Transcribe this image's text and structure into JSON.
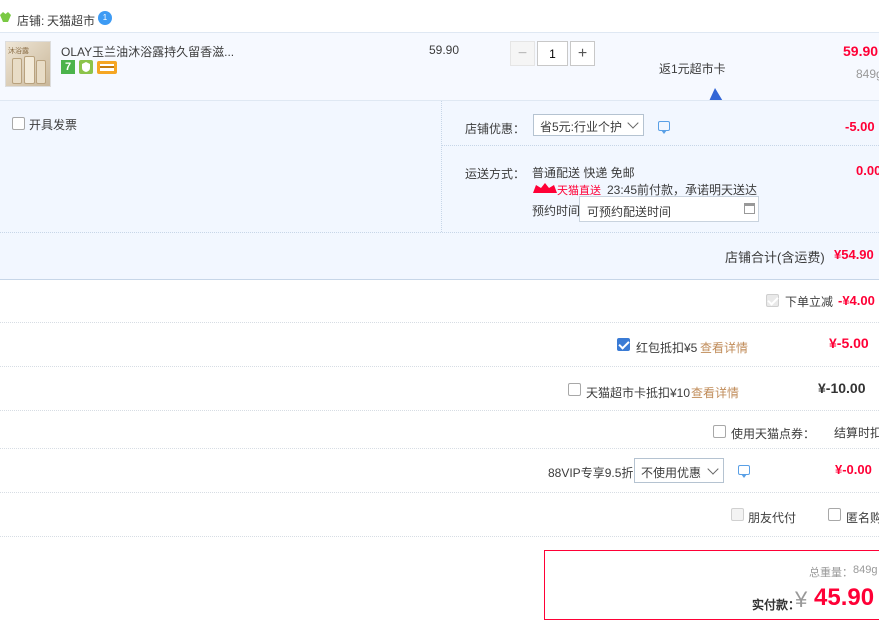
{
  "shop": {
    "label": "店铺:",
    "name": "天猫超市",
    "badge": "1"
  },
  "item": {
    "title": "OLAY玉兰油沐浴露持久留香滋...",
    "thumb_text": "沐浴露",
    "unit_price": "59.90",
    "quantity": "1",
    "minus": "−",
    "plus": "+",
    "promo": "返1元超市卡",
    "total": "59.90",
    "weight": "849g"
  },
  "invoice": {
    "label": "开具发票"
  },
  "shop_discount": {
    "label": "店铺优惠：",
    "selected": "省5元:行业个护",
    "amount": "-5.00"
  },
  "shipping": {
    "label": "运送方式：",
    "method": "普通配送 快递 免邮",
    "badge": "天猫直送",
    "promise": "23:45前付款，承诺明天送达",
    "reserve_label": "预约时间",
    "reserve_placeholder": "可预约配送时间",
    "amount": "0.00"
  },
  "shop_total": {
    "label": "店铺合计(含运费)",
    "amount": "¥54.90"
  },
  "order_discount": {
    "label": "下单立减",
    "amount": "-¥4.00"
  },
  "redpacket": {
    "label": "红包抵扣¥5",
    "link": "查看详情",
    "amount": "¥-5.00"
  },
  "supermarket_card": {
    "label": "天猫超市卡抵扣¥10",
    "link": "查看详情",
    "amount": "¥-10.00"
  },
  "points": {
    "label": "使用天猫点券：",
    "note": "结算时扣除"
  },
  "vip": {
    "label": "88VIP专享9.5折",
    "selected": "不使用优惠",
    "amount": "¥-0.00"
  },
  "friend_pay": {
    "label": "朋友代付"
  },
  "anonymous": {
    "label": "匿名购买"
  },
  "summary": {
    "weight_label": "总重量：",
    "weight": "849g",
    "pay_label": "实付款：",
    "currency": "¥",
    "amount": "45.90"
  },
  "colors": {
    "accent_red": "#ff0036",
    "panel_blue": "#f2f7ff",
    "arrow_blue": "#3366d6"
  }
}
